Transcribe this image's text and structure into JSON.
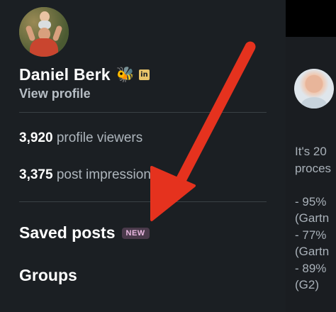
{
  "profile": {
    "name": "Daniel Berk",
    "badge_emoji": "🐝",
    "linkedin_badge": "in",
    "view_profile_label": "View profile"
  },
  "stats": {
    "viewers_count": "3,920",
    "viewers_label": "profile viewers",
    "impressions_count": "3,375",
    "impressions_label": "post impressions"
  },
  "menu": {
    "saved_posts_label": "Saved posts",
    "saved_posts_badge": "NEW",
    "groups_label": "Groups"
  },
  "feed_preview": {
    "text": "It's 20\nproces\n\n- 95%\n(Gartn\n- 77%\n(Gartn\n- 89%\n(G2)"
  },
  "colors": {
    "drawer_bg": "#1b1f23",
    "arrow": "#e5321e",
    "new_badge_bg": "#4a3a4b",
    "new_badge_text": "#e9b7e0",
    "linkedin_badge": "#e8c46a"
  },
  "icons": {
    "annotation": "red-arrow-pointing-to-saved-posts"
  }
}
